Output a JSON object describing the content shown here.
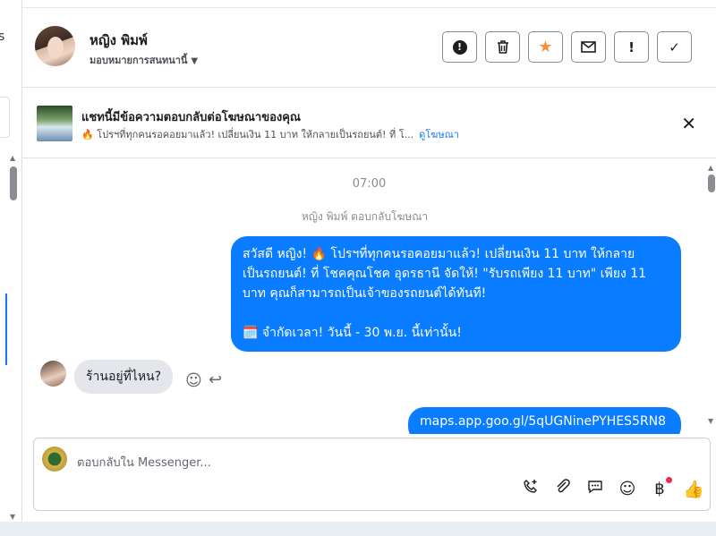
{
  "left_column": {
    "fragment_text": "s"
  },
  "header": {
    "contact_name": "หญิง พิมพ์",
    "assign_label": "มอบหมายการสนทนานี้",
    "actions": [
      {
        "icon": "report-icon",
        "glyph": "!"
      },
      {
        "icon": "trash-icon",
        "glyph": "🗑"
      },
      {
        "icon": "star-icon",
        "glyph": "★"
      },
      {
        "icon": "envelope-icon",
        "glyph": "✉"
      },
      {
        "icon": "exclamation-icon",
        "glyph": "!"
      },
      {
        "icon": "check-icon",
        "glyph": "✓"
      }
    ]
  },
  "ad_banner": {
    "title": "แชทนี้มีข้อความตอบกลับต่อโฆษณาของคุณ",
    "subtitle": "🔥 โปรฯที่ทุกคนรอคอยมาแล้ว! เปลี่ยนเงิน 11 บาท ให้กลายเป็นรถยนต์! ที่ โ...",
    "link": "ดูโฆษณา"
  },
  "thread": {
    "time": "07:00",
    "replied_note": "หญิง พิมพ์ ตอบกลับโฆษณา",
    "outgoing_message": {
      "line1": "สวัสดี หญิง!  🔥 โปรฯที่ทุกคนรอคอยมาแล้ว! เปลี่ยนเงิน 11 บาท ให้กลาย",
      "line2": "เป็นรถยนต์! ที่ โชคคุณโชค อุดรธานี จัดให้! \"รับรถเพียง 11 บาท\" เพียง 11",
      "line3": "บาท คุณก็สามารถเป็นเจ้าของรถยนต์ได้ทันที!",
      "line4": "🗓️ จำกัดเวลา! วันนี้ - 30 พ.ย. นี้เท่านั้น!"
    },
    "incoming_message": "ร้านอยู่ที่ไหน?",
    "outgoing_link": "maps.app.goo.gl/5qUGNinePYHES5RN8"
  },
  "composer": {
    "placeholder": "ตอบกลับใน Messenger...",
    "tools": [
      "phone-add-icon",
      "paperclip-icon",
      "chat-bubble-icon",
      "emoji-icon",
      "baht-icon",
      "thumbs-up-icon"
    ]
  },
  "colors": {
    "brand_blue": "#0a7cff",
    "star": "#f7923b",
    "notification_dot": "#f02849"
  }
}
